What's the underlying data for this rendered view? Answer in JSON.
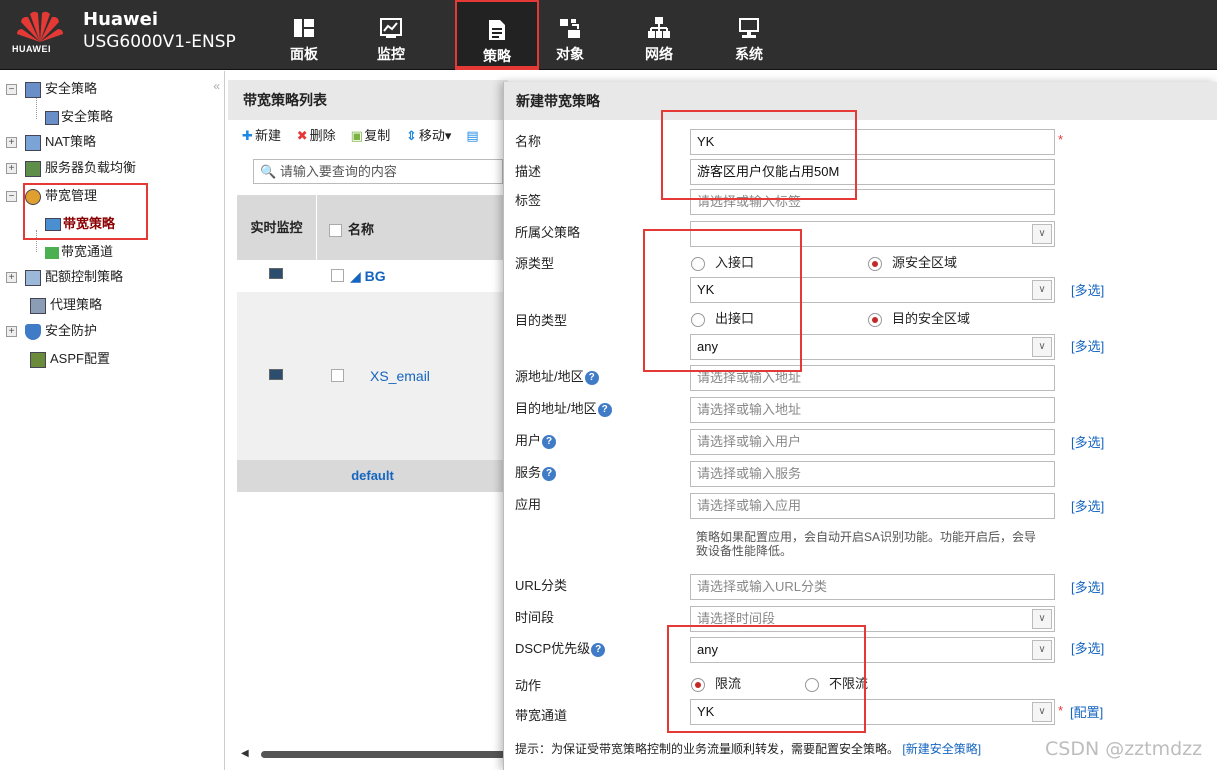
{
  "brand": {
    "name": "Huawei",
    "model": "USG6000V1-ENSP",
    "logo_text": "HUAWEI"
  },
  "nav": [
    {
      "label": "面板",
      "icon": "dashboard-icon"
    },
    {
      "label": "监控",
      "icon": "monitor-chart-icon"
    },
    {
      "label": "策略",
      "icon": "policy-document-icon",
      "active": true
    },
    {
      "label": "对象",
      "icon": "object-icon"
    },
    {
      "label": "网络",
      "icon": "network-icon"
    },
    {
      "label": "系统",
      "icon": "system-computer-icon"
    }
  ],
  "tree": {
    "collapse_glyph": "«",
    "items": [
      {
        "label": "安全策略"
      },
      {
        "label": "安全策略"
      },
      {
        "label": "NAT策略"
      },
      {
        "label": "服务器负载均衡"
      },
      {
        "label": "带宽管理"
      },
      {
        "label": "带宽策略",
        "selected": true
      },
      {
        "label": "带宽通道"
      },
      {
        "label": "配额控制策略"
      },
      {
        "label": "代理策略"
      },
      {
        "label": "安全防护"
      },
      {
        "label": "ASPF配置"
      }
    ]
  },
  "list": {
    "title": "带宽策略列表",
    "toolbar": {
      "new": "新建",
      "delete": "删除",
      "copy": "复制",
      "move": "移动▾"
    },
    "search_placeholder": "请输入要查询的内容",
    "columns": {
      "monitor": "实时监控",
      "name": "名称"
    },
    "rows": [
      {
        "name": "◢ BG"
      },
      {
        "name": "XS_email"
      }
    ],
    "default_row": "default"
  },
  "dialog": {
    "title": "新建带宽策略",
    "labels": {
      "name": "名称",
      "desc": "描述",
      "tag": "标签",
      "parent": "所属父策略",
      "src_type": "源类型",
      "dst_type": "目的类型",
      "src_addr": "源地址/地区",
      "dst_addr": "目的地址/地区",
      "user": "用户",
      "service": "服务",
      "app": "应用",
      "url": "URL分类",
      "time": "时间段",
      "dscp": "DSCP优先级",
      "action": "动作",
      "channel": "带宽通道"
    },
    "values": {
      "name": "YK",
      "desc": "游客区用户仅能占用50M",
      "tag_placeholder": "请选择或输入标签",
      "parent": "",
      "src_zone": "YK",
      "dst_zone": "any",
      "src_addr_placeholder": "请选择或输入地址",
      "dst_addr_placeholder": "请选择或输入地址",
      "user_placeholder": "请选择或输入用户",
      "service_placeholder": "请选择或输入服务",
      "app_placeholder": "请选择或输入应用",
      "url_placeholder": "请选择或输入URL分类",
      "time_placeholder": "请选择时间段",
      "dscp": "any",
      "channel": "YK"
    },
    "radios": {
      "in_iface": "入接口",
      "src_zone": "源安全区域",
      "out_iface": "出接口",
      "dst_zone": "目的安全区域",
      "limit": "限流",
      "no_limit": "不限流"
    },
    "multi_select": "[多选]",
    "config_link": "[配置]",
    "required_mark": "*",
    "help_glyph": "?",
    "app_note": "策略如果配置应用，会自动开启SA识别功能。功能开启后，会导致设备性能降低。",
    "tip_text": "提示：为保证受带宽策略控制的业务流量顺利转发，需要配置安全策略。",
    "tip_link": "[新建安全策略]"
  },
  "watermark": "CSDN @zztmdzz",
  "colors": {
    "topbar": "#2f2f2f",
    "accent_red": "#e53935",
    "link_blue": "#1565c0",
    "selected_tree": "#8b0000"
  }
}
